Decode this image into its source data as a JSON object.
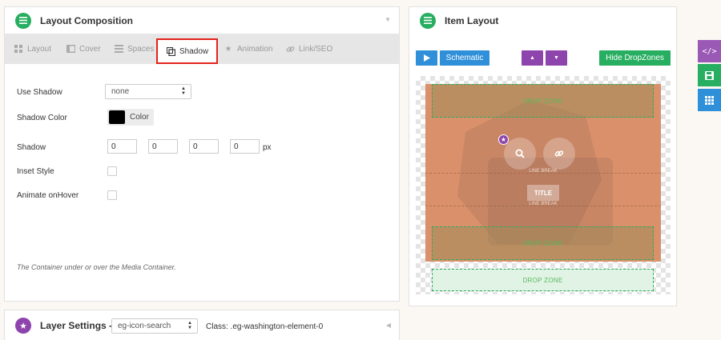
{
  "layout_panel": {
    "title": "Layout Composition",
    "tabs": [
      {
        "label": "Layout",
        "icon": "grid-icon"
      },
      {
        "label": "Cover",
        "icon": "cover-icon"
      },
      {
        "label": "Spaces",
        "icon": "spaces-icon"
      },
      {
        "label": "Shadow",
        "icon": "shadow-icon"
      },
      {
        "label": "Animation",
        "icon": "star-icon"
      },
      {
        "label": "Link/SEO",
        "icon": "link-icon"
      }
    ],
    "active_tab": "Shadow",
    "fields": {
      "use_shadow_label": "Use Shadow",
      "use_shadow_value": "none",
      "shadow_color_label": "Shadow Color",
      "color_button_label": "Color",
      "color_value": "#000000",
      "shadow_label": "Shadow",
      "shadow_values": [
        "0",
        "0",
        "0",
        "0"
      ],
      "shadow_unit": "px",
      "inset_label": "Inset Style",
      "animate_label": "Animate onHover"
    },
    "note": "The Container under or over the Media Container."
  },
  "item_layout": {
    "title": "Item Layout",
    "schematic_label": "Schematic",
    "hide_dropzones_label": "Hide DropZones",
    "drop_zone_label": "DROP ZONE",
    "line_break_label": "LINE BREAK",
    "title_chip": "TITLE"
  },
  "layer_settings": {
    "title": "Layer Settings -",
    "select_value": "eg-icon-search",
    "class_text": "Class: .eg-washington-element-0"
  },
  "colors": {
    "accent_green": "#27ae60",
    "accent_blue": "#2f8fd8",
    "accent_purple": "#8e44ad",
    "highlight_red": "#e2231a",
    "media_bg": "#d9906b"
  }
}
